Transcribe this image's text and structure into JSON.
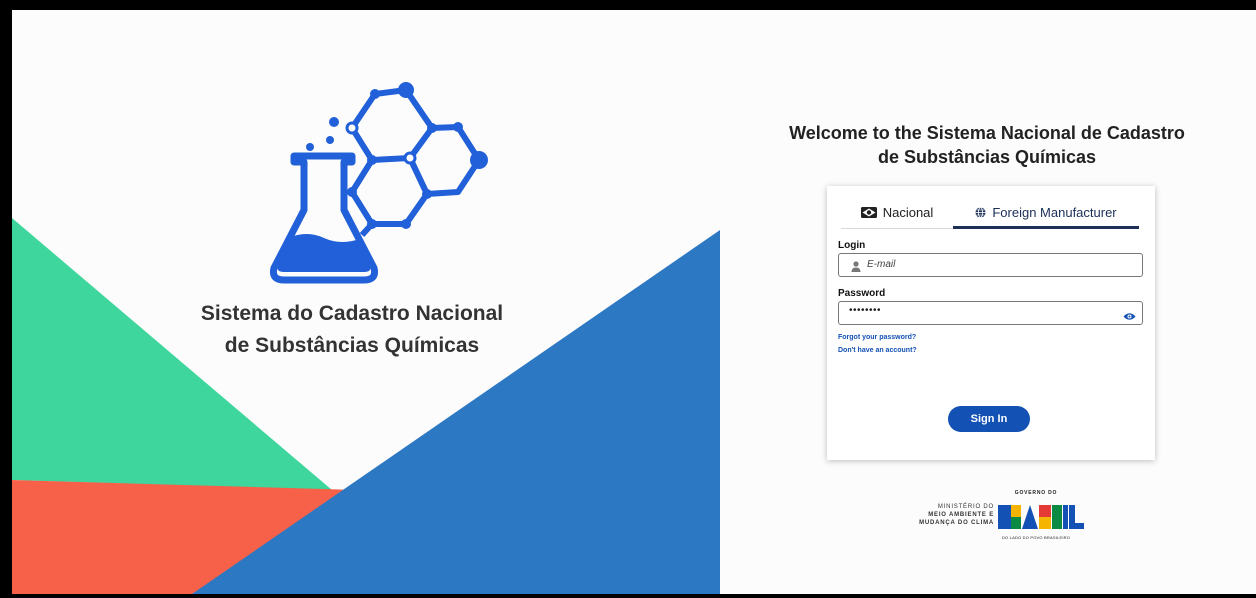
{
  "brand": {
    "title_line1": "Sistema do Cadastro Nacional",
    "title_line2": "de Substâncias Químicas"
  },
  "welcome": {
    "line1": "Welcome to the Sistema Nacional de Cadastro",
    "line2": "de Substâncias Químicas"
  },
  "tabs": [
    {
      "label": "Nacional",
      "icon": "brazil-flag-icon",
      "active": false
    },
    {
      "label": "Foreign Manufacturer",
      "icon": "globe-icon",
      "active": true
    }
  ],
  "login": {
    "label": "Login",
    "placeholder": "E-mail",
    "icon": "user-icon"
  },
  "password": {
    "label": "Password",
    "masked_value": "••••••••",
    "toggle_icon": "eye-icon"
  },
  "links": {
    "forgot": "Forgot your password?",
    "signup": "Don't have an account?"
  },
  "sign_in_label": "Sign In",
  "footer": {
    "ministry_line1": "MINISTÉRIO DO",
    "ministry_line2": "MEIO AMBIENTE E",
    "ministry_line3": "MUDANÇA DO CLIMA",
    "gov_top": "GOVERNO DO",
    "gov_word": "BRASIL",
    "gov_tagline": "DO LADO DO POVO BRASILEIRO"
  },
  "colors": {
    "primary": "#1351b4",
    "tab_active": "#1b2f57",
    "shape_green": "#3ed69c",
    "shape_red": "#f7614a",
    "shape_blue": "#2c78c2",
    "logo_blue": "#2160d8"
  }
}
